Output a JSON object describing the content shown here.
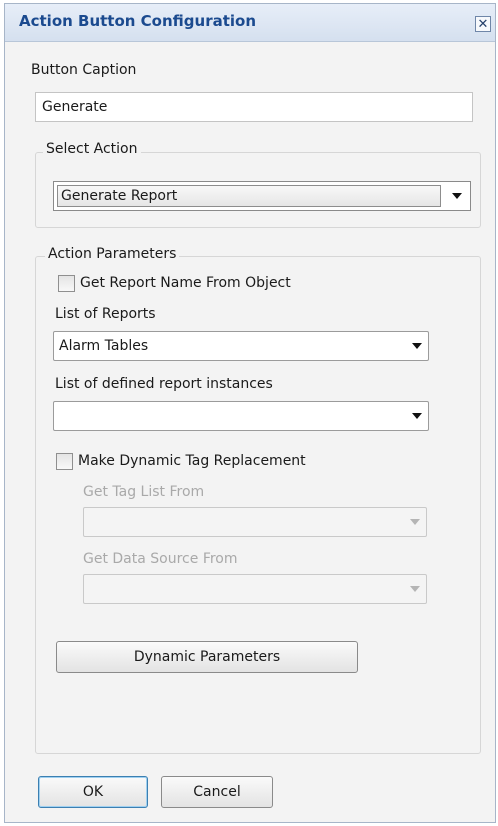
{
  "window": {
    "title": "Action Button Configuration",
    "close_glyph": "✕"
  },
  "button_caption": {
    "label": "Button Caption",
    "value": "Generate"
  },
  "select_action": {
    "legend": "Select Action",
    "selected": "Generate Report"
  },
  "action_parameters": {
    "legend": "Action Parameters",
    "get_report_name_checkbox": {
      "label": "Get Report Name From Object",
      "checked": false
    },
    "list_of_reports": {
      "label": "List of Reports",
      "selected": "Alarm Tables"
    },
    "report_instances": {
      "label": "List of defined report instances",
      "selected": ""
    },
    "dynamic_tag_checkbox": {
      "label": "Make Dynamic Tag Replacement",
      "checked": false
    },
    "tag_list_from": {
      "label": "Get Tag List From",
      "selected": "",
      "enabled": false
    },
    "data_source_from": {
      "label": "Get Data Source From",
      "selected": "",
      "enabled": false
    },
    "dynamic_parameters_button": "Dynamic Parameters"
  },
  "footer": {
    "ok_label": "OK",
    "cancel_label": "Cancel"
  },
  "colors": {
    "title_text": "#1b4a8f",
    "titlebar_bg": "#dce6f2",
    "disabled_text": "#a9a9a9",
    "default_button_border": "#3c7fb1"
  }
}
